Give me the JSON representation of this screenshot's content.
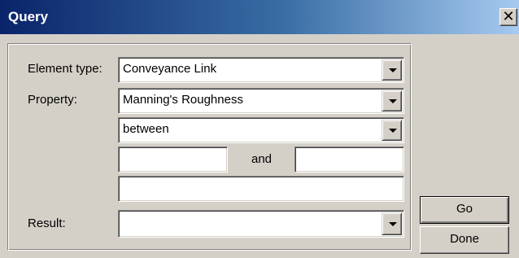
{
  "window": {
    "title": "Query",
    "close_glyph": "✕"
  },
  "form": {
    "element_type_label": "Element type:",
    "element_type_value": "Conveyance Link",
    "property_label": "Property:",
    "property_value": "Manning's Roughness",
    "operator_value": "between",
    "value_from": "",
    "and_label": "and",
    "value_to": "",
    "extra_value": "",
    "result_label": "Result:",
    "result_value": ""
  },
  "buttons": {
    "go_label": "Go",
    "done_label": "Done"
  },
  "icons": {
    "close": "close-icon",
    "dropdown": "chevron-down-icon"
  }
}
